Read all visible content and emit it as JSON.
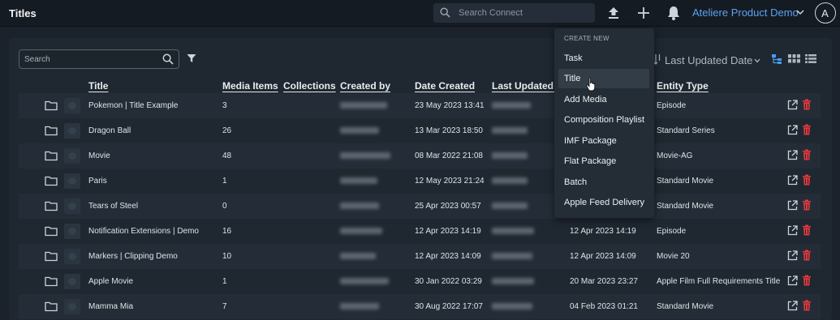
{
  "topbar": {
    "title": "Titles",
    "search_placeholder": "Search Connect",
    "org_name": "Ateliere Product Demo",
    "avatar_initial": "A",
    "accent": "#5aa2f2"
  },
  "toolbar": {
    "search_placeholder": "Search",
    "sort_label": "Last Updated Date"
  },
  "columns": [
    "Title",
    "Media Items",
    "Collections",
    "Created by",
    "Date Created",
    "Last Updated B",
    "Entity Type"
  ],
  "rows": [
    {
      "title": "Pokemon | Title Example",
      "media": "3",
      "date_created": "23 May 2023 13:41",
      "last_updated": "",
      "entity": "Episode"
    },
    {
      "title": "Dragon Ball",
      "media": "26",
      "date_created": "13 Mar 2023 18:50",
      "last_updated": "",
      "entity": "Standard Series"
    },
    {
      "title": "Movie",
      "media": "48",
      "date_created": "08 Mar 2022 21:08",
      "last_updated": "",
      "entity": "Movie-AG"
    },
    {
      "title": "Paris",
      "media": "1",
      "date_created": "12 May 2023 21:24",
      "last_updated": "",
      "entity": "Standard Movie"
    },
    {
      "title": "Tears of Steel",
      "media": "0",
      "date_created": "25 Apr 2023 00:57",
      "last_updated": "",
      "entity": "Standard Movie"
    },
    {
      "title": "Notification Extensions | Demo",
      "media": "16",
      "date_created": "12 Apr 2023 14:19",
      "last_updated": "12 Apr 2023 14:19",
      "entity": "Episode"
    },
    {
      "title": "Markers | Clipping Demo",
      "media": "10",
      "date_created": "12 Apr 2023 14:09",
      "last_updated": "12 Apr 2023 14:09",
      "entity": "Movie 20"
    },
    {
      "title": "Apple Movie",
      "media": "1",
      "date_created": "30 Jan 2022 03:29",
      "last_updated": "20 Mar 2023 23:27",
      "entity": "Apple Film Full Requirements Title"
    },
    {
      "title": "Mamma Mia",
      "media": "7",
      "date_created": "30 Aug 2022 17:07",
      "last_updated": "04 Feb 2023 01:21",
      "entity": "Standard Movie"
    }
  ],
  "menu": {
    "header": "CREATE NEW",
    "items": [
      "Task",
      "Title",
      "Add Media",
      "Composition Playlist",
      "IMF Package",
      "Flat Package",
      "Batch",
      "Apple Feed Delivery"
    ],
    "highlighted": "Title"
  },
  "colors": {
    "delete": "#e0393e",
    "accent": "#5aa2f2"
  }
}
